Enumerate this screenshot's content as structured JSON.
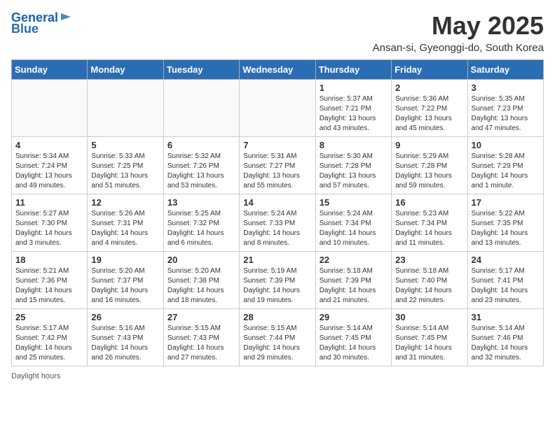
{
  "logo": {
    "line1": "General",
    "line2": "Blue"
  },
  "title": "May 2025",
  "subtitle": "Ansan-si, Gyeonggi-do, South Korea",
  "days_of_week": [
    "Sunday",
    "Monday",
    "Tuesday",
    "Wednesday",
    "Thursday",
    "Friday",
    "Saturday"
  ],
  "weeks": [
    [
      {
        "day": "",
        "info": ""
      },
      {
        "day": "",
        "info": ""
      },
      {
        "day": "",
        "info": ""
      },
      {
        "day": "",
        "info": ""
      },
      {
        "day": "1",
        "info": "Sunrise: 5:37 AM\nSunset: 7:21 PM\nDaylight: 13 hours\nand 43 minutes."
      },
      {
        "day": "2",
        "info": "Sunrise: 5:36 AM\nSunset: 7:22 PM\nDaylight: 13 hours\nand 45 minutes."
      },
      {
        "day": "3",
        "info": "Sunrise: 5:35 AM\nSunset: 7:23 PM\nDaylight: 13 hours\nand 47 minutes."
      }
    ],
    [
      {
        "day": "4",
        "info": "Sunrise: 5:34 AM\nSunset: 7:24 PM\nDaylight: 13 hours\nand 49 minutes."
      },
      {
        "day": "5",
        "info": "Sunrise: 5:33 AM\nSunset: 7:25 PM\nDaylight: 13 hours\nand 51 minutes."
      },
      {
        "day": "6",
        "info": "Sunrise: 5:32 AM\nSunset: 7:26 PM\nDaylight: 13 hours\nand 53 minutes."
      },
      {
        "day": "7",
        "info": "Sunrise: 5:31 AM\nSunset: 7:27 PM\nDaylight: 13 hours\nand 55 minutes."
      },
      {
        "day": "8",
        "info": "Sunrise: 5:30 AM\nSunset: 7:28 PM\nDaylight: 13 hours\nand 57 minutes."
      },
      {
        "day": "9",
        "info": "Sunrise: 5:29 AM\nSunset: 7:28 PM\nDaylight: 13 hours\nand 59 minutes."
      },
      {
        "day": "10",
        "info": "Sunrise: 5:28 AM\nSunset: 7:29 PM\nDaylight: 14 hours\nand 1 minute."
      }
    ],
    [
      {
        "day": "11",
        "info": "Sunrise: 5:27 AM\nSunset: 7:30 PM\nDaylight: 14 hours\nand 3 minutes."
      },
      {
        "day": "12",
        "info": "Sunrise: 5:26 AM\nSunset: 7:31 PM\nDaylight: 14 hours\nand 4 minutes."
      },
      {
        "day": "13",
        "info": "Sunrise: 5:25 AM\nSunset: 7:32 PM\nDaylight: 14 hours\nand 6 minutes."
      },
      {
        "day": "14",
        "info": "Sunrise: 5:24 AM\nSunset: 7:33 PM\nDaylight: 14 hours\nand 8 minutes."
      },
      {
        "day": "15",
        "info": "Sunrise: 5:24 AM\nSunset: 7:34 PM\nDaylight: 14 hours\nand 10 minutes."
      },
      {
        "day": "16",
        "info": "Sunrise: 5:23 AM\nSunset: 7:34 PM\nDaylight: 14 hours\nand 11 minutes."
      },
      {
        "day": "17",
        "info": "Sunrise: 5:22 AM\nSunset: 7:35 PM\nDaylight: 14 hours\nand 13 minutes."
      }
    ],
    [
      {
        "day": "18",
        "info": "Sunrise: 5:21 AM\nSunset: 7:36 PM\nDaylight: 14 hours\nand 15 minutes."
      },
      {
        "day": "19",
        "info": "Sunrise: 5:20 AM\nSunset: 7:37 PM\nDaylight: 14 hours\nand 16 minutes."
      },
      {
        "day": "20",
        "info": "Sunrise: 5:20 AM\nSunset: 7:38 PM\nDaylight: 14 hours\nand 18 minutes."
      },
      {
        "day": "21",
        "info": "Sunrise: 5:19 AM\nSunset: 7:39 PM\nDaylight: 14 hours\nand 19 minutes."
      },
      {
        "day": "22",
        "info": "Sunrise: 5:18 AM\nSunset: 7:39 PM\nDaylight: 14 hours\nand 21 minutes."
      },
      {
        "day": "23",
        "info": "Sunrise: 5:18 AM\nSunset: 7:40 PM\nDaylight: 14 hours\nand 22 minutes."
      },
      {
        "day": "24",
        "info": "Sunrise: 5:17 AM\nSunset: 7:41 PM\nDaylight: 14 hours\nand 23 minutes."
      }
    ],
    [
      {
        "day": "25",
        "info": "Sunrise: 5:17 AM\nSunset: 7:42 PM\nDaylight: 14 hours\nand 25 minutes."
      },
      {
        "day": "26",
        "info": "Sunrise: 5:16 AM\nSunset: 7:43 PM\nDaylight: 14 hours\nand 26 minutes."
      },
      {
        "day": "27",
        "info": "Sunrise: 5:15 AM\nSunset: 7:43 PM\nDaylight: 14 hours\nand 27 minutes."
      },
      {
        "day": "28",
        "info": "Sunrise: 5:15 AM\nSunset: 7:44 PM\nDaylight: 14 hours\nand 29 minutes."
      },
      {
        "day": "29",
        "info": "Sunrise: 5:14 AM\nSunset: 7:45 PM\nDaylight: 14 hours\nand 30 minutes."
      },
      {
        "day": "30",
        "info": "Sunrise: 5:14 AM\nSunset: 7:45 PM\nDaylight: 14 hours\nand 31 minutes."
      },
      {
        "day": "31",
        "info": "Sunrise: 5:14 AM\nSunset: 7:46 PM\nDaylight: 14 hours\nand 32 minutes."
      }
    ]
  ],
  "footer": "Daylight hours"
}
